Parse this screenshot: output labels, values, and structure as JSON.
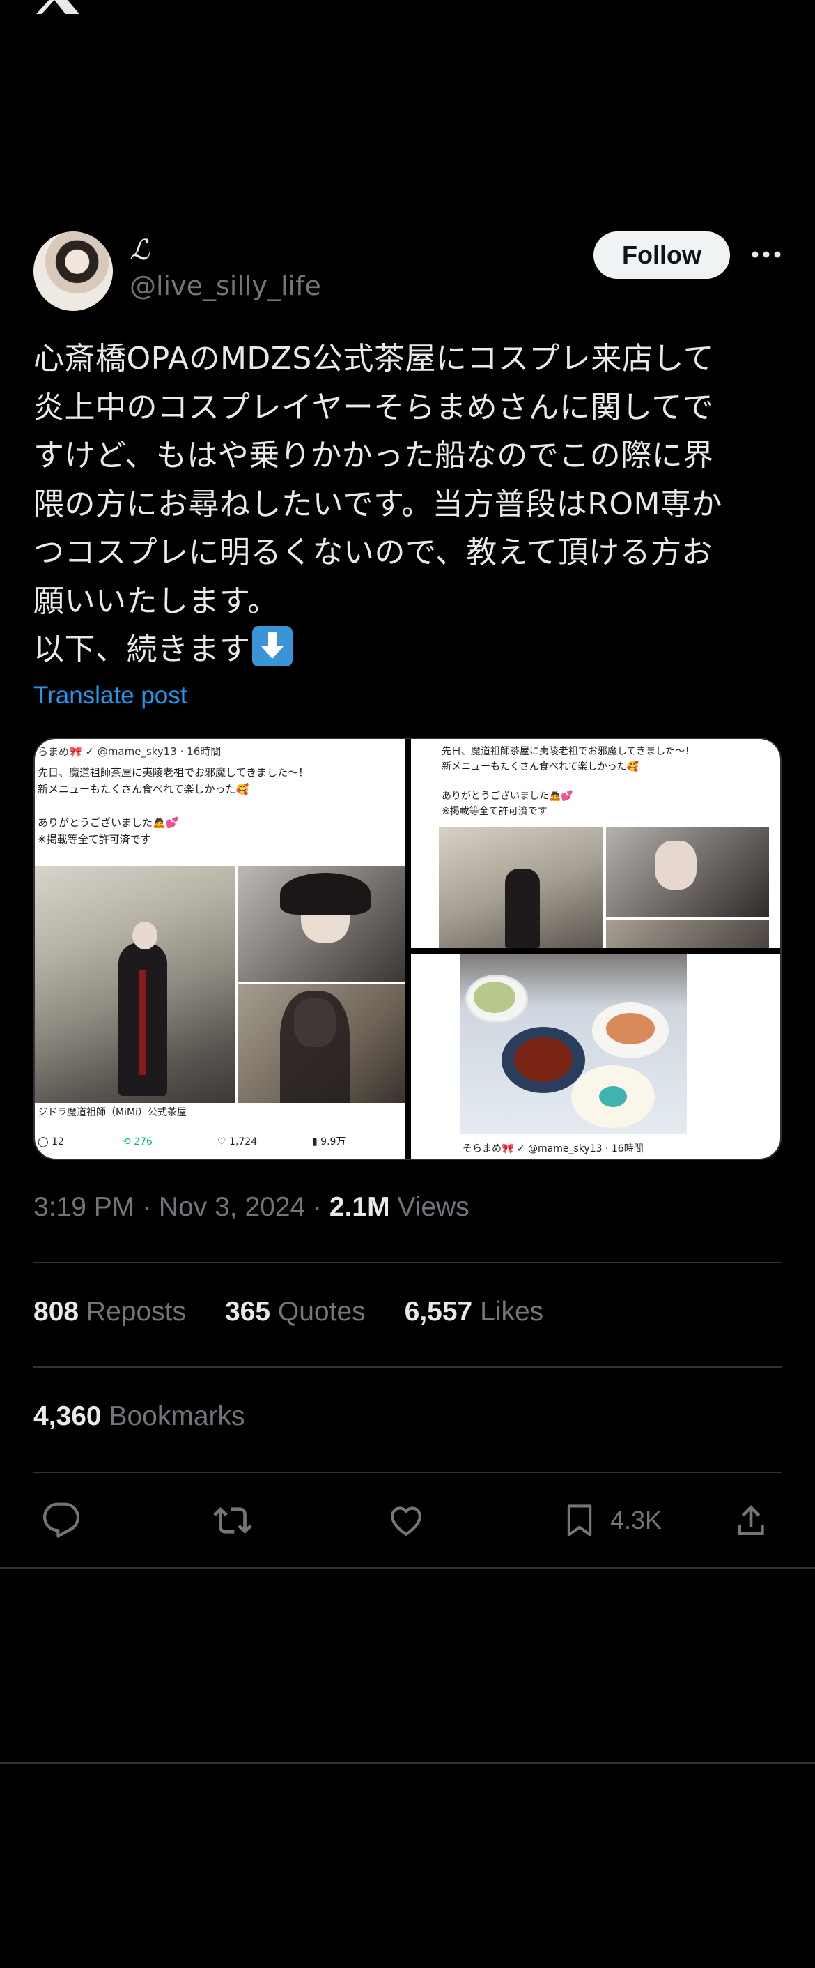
{
  "header": {
    "logo_icon": "x-logo-icon"
  },
  "author": {
    "display_name": "ℒ",
    "handle": "@live_silly_life",
    "follow_label": "Follow",
    "more_icon": "more-icon"
  },
  "post": {
    "text": "心斎橋OPAのMDZS公式茶屋にコスプレ来店して\n炎上中のコスプレイヤーそらまめさんに関してで\nすけど、もはや乗りかかった船なのでこの際に界\n隈の方にお尋ねしたいです。当方普段はROM専か\nつコスプレに明るくないので、教えて頂ける方お\n願いいたします。\n以下、続きます",
    "emoji_icon": "down-arrow-emoji-icon",
    "translate_label": "Translate post"
  },
  "media": {
    "left": {
      "header": "らまめ🎀 ✓ @mame_sky13 · 16時間",
      "line1": "先日、魔道祖師茶屋に夷陵老祖でお邪魔してきました〜！",
      "line2": "新メニューもたくさん食べれて楽しかった🥰",
      "line3": "ありがとうございました🙇💕",
      "line4": "※掲載等全て許可済です",
      "caption": "ジドラ魔道祖師（MiMi）公式茶屋",
      "replies": "12",
      "reposts": "276",
      "likes": "1,724",
      "views": "9.9万"
    },
    "right_top": {
      "line1": "先日、魔道祖師茶屋に夷陵老祖でお邪魔してきました〜！",
      "line2": "新メニューもたくさん食べれて楽しかった🥰",
      "line3": "ありがとうございました🙇💕",
      "line4": "※掲載等全て許可済です"
    },
    "right_bottom": {
      "footer": "そらまめ🎀 ✓ @mame_sky13 · 16時間"
    }
  },
  "meta": {
    "time": "3:19 PM · Nov 3, 2024 · ",
    "views_count": "2.1M",
    "views_label": " Views"
  },
  "stats": {
    "reposts_count": "808",
    "reposts_label": " Reposts",
    "quotes_count": "365",
    "quotes_label": " Quotes",
    "likes_count": "6,557",
    "likes_label": " Likes",
    "bookmarks_count": "4,360",
    "bookmarks_label": " Bookmarks"
  },
  "actions": {
    "reply_icon": "reply-icon",
    "repost_icon": "repost-icon",
    "like_icon": "heart-icon",
    "bookmark_icon": "bookmark-icon",
    "bookmark_count": "4.3K",
    "share_icon": "share-icon"
  },
  "colors": {
    "accent": "#1d9bf0",
    "text": "#e7e9ea",
    "muted": "#71767b",
    "divider": "#2f3336"
  }
}
